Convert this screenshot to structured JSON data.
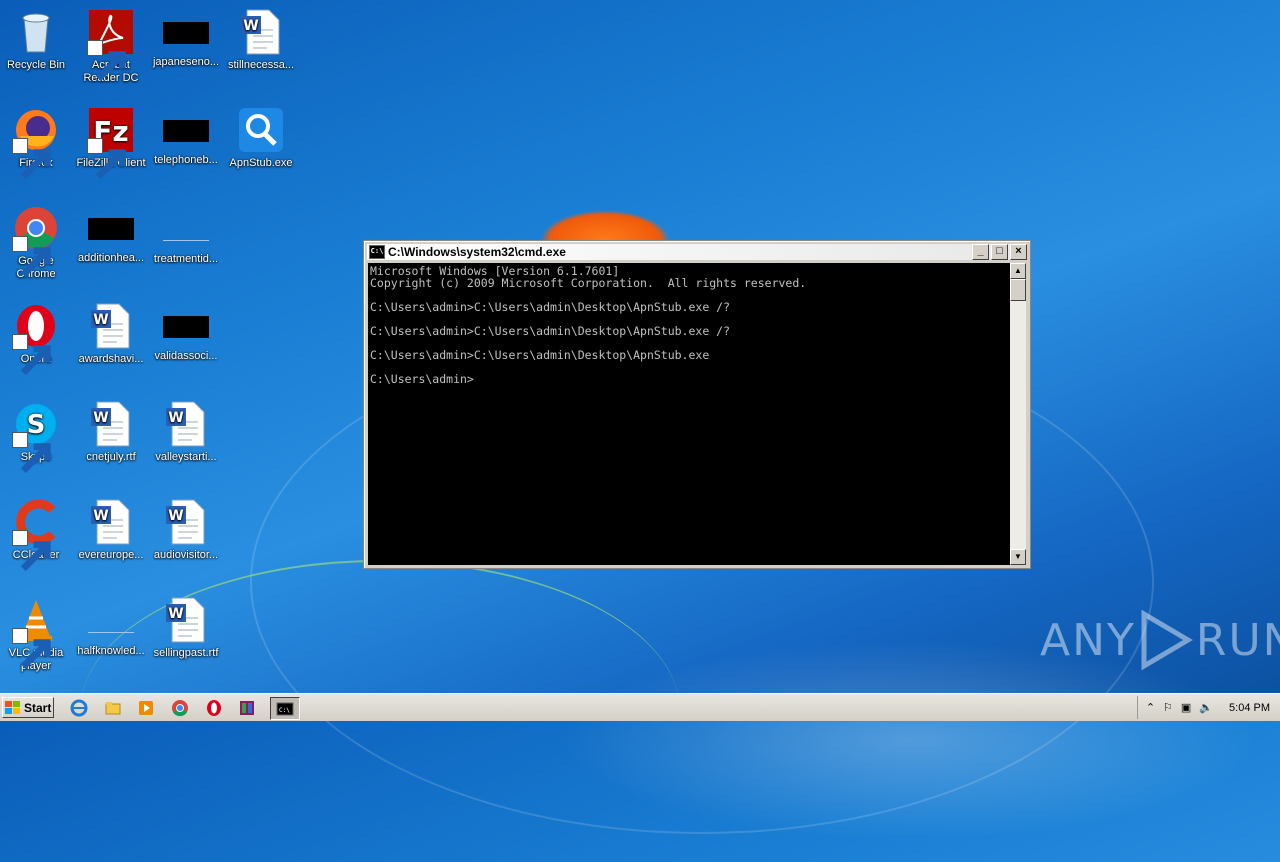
{
  "desktop": {
    "icons": [
      {
        "label": "Recycle Bin"
      },
      {
        "label": "Acrobat Reader DC"
      },
      {
        "label": "japaneseno..."
      },
      {
        "label": "stillnecessa..."
      },
      {
        "label": "Firefox"
      },
      {
        "label": "FileZilla Client"
      },
      {
        "label": "telephoneb..."
      },
      {
        "label": "ApnStub.exe"
      },
      {
        "label": "Google Chrome"
      },
      {
        "label": "additionhea..."
      },
      {
        "label": "treatmentid..."
      },
      {
        "label": "Opera"
      },
      {
        "label": "awardshavi..."
      },
      {
        "label": "validassoci..."
      },
      {
        "label": "Skype"
      },
      {
        "label": "cnetjuly.rtf"
      },
      {
        "label": "valleystarti..."
      },
      {
        "label": "CCleaner"
      },
      {
        "label": "evereurope..."
      },
      {
        "label": "audiovisitor..."
      },
      {
        "label": "VLC media player"
      },
      {
        "label": "halfknowled..."
      },
      {
        "label": "sellingpast.rtf"
      }
    ]
  },
  "cmd": {
    "title": "C:\\Windows\\system32\\cmd.exe",
    "icon_text": "C:\\",
    "minimize": "_",
    "maximize": "□",
    "close": "×",
    "lines": [
      "Microsoft Windows [Version 6.1.7601]",
      "Copyright (c) 2009 Microsoft Corporation.  All rights reserved.",
      "",
      "C:\\Users\\admin>C:\\Users\\admin\\Desktop\\ApnStub.exe /?",
      "",
      "C:\\Users\\admin>C:\\Users\\admin\\Desktop\\ApnStub.exe /?",
      "",
      "C:\\Users\\admin>C:\\Users\\admin\\Desktop\\ApnStub.exe",
      "",
      "C:\\Users\\admin>"
    ]
  },
  "taskbar": {
    "start_label": "Start",
    "clock": "5:04 PM"
  },
  "watermark": {
    "left": "ANY",
    "right": "RUN"
  },
  "colors": {
    "desktop": "#1a7fd4",
    "console_bg": "#000000",
    "console_fg": "#c0c0c0"
  }
}
